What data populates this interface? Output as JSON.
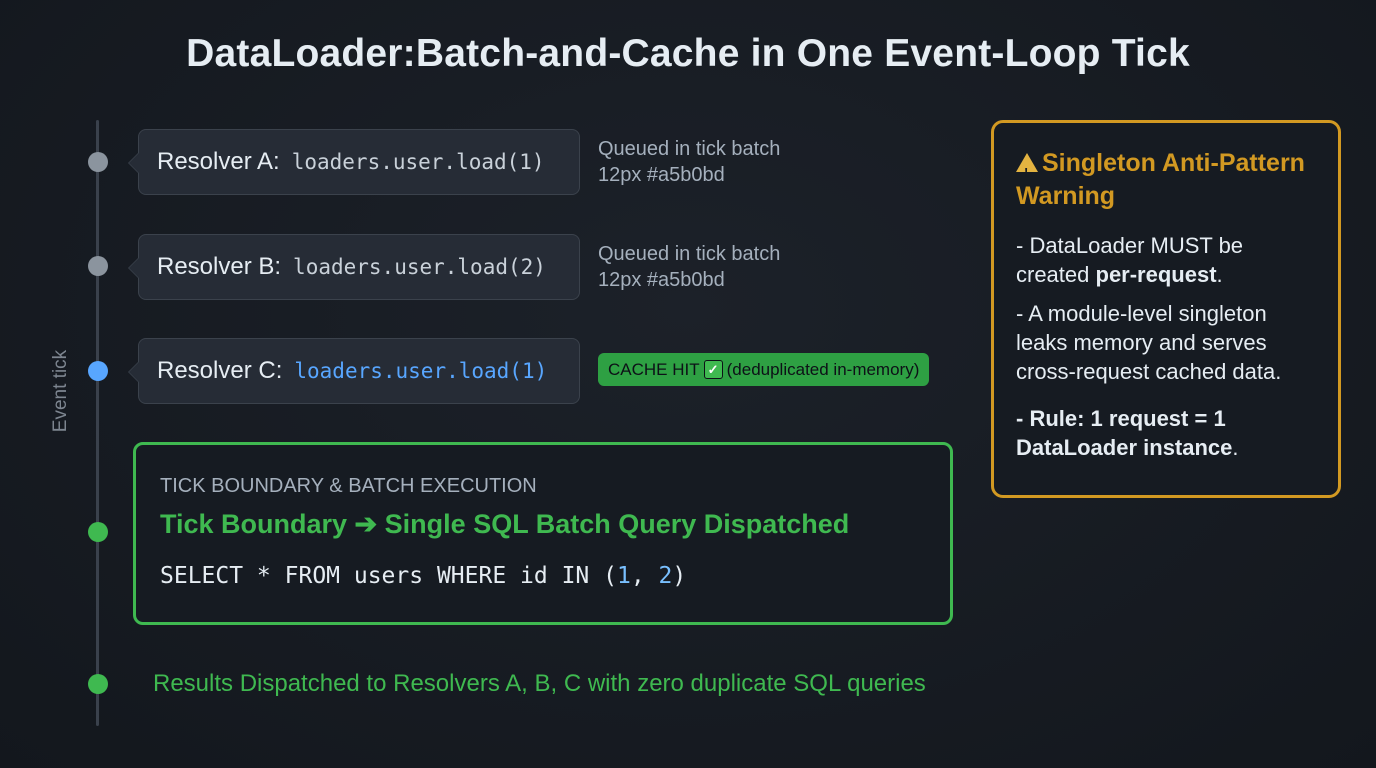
{
  "title": "DataLoader:Batch-and-Cache in One Event-Loop Tick",
  "axis_label": "Event tick",
  "resolvers": [
    {
      "label": "Resolver A:",
      "code": "loaders.user.load(1)",
      "note_line1": "Queued in tick batch",
      "note_line2": "12px #a5b0bd"
    },
    {
      "label": "Resolver B:",
      "code": "loaders.user.load(2)",
      "note_line1": "Queued in tick batch",
      "note_line2": "12px #a5b0bd"
    },
    {
      "label": "Resolver C:",
      "code": "loaders.user.load(1)",
      "badge_before": "CACHE HIT",
      "badge_after": "(deduplicated in-memory)"
    }
  ],
  "batch": {
    "heading": "TICK BOUNDARY & BATCH EXECUTION",
    "subheading": "Tick Boundary ➔ Single SQL Batch Query Dispatched",
    "sql_prefix": "SELECT * FROM users WHERE id IN (",
    "sql_id1": "1",
    "sql_sep": ", ",
    "sql_id2": "2",
    "sql_suffix": ")"
  },
  "results": "Results Dispatched to Resolvers A, B, C with zero duplicate SQL queries",
  "warning": {
    "title": "Singleton Anti-Pattern Warning",
    "item1_a": "- DataLoader MUST be created ",
    "item1_bold": "per-request",
    "item1_b": ".",
    "item2": "- A module-level singleton leaks memory and serves cross-request cached data.",
    "item3_bold": "- Rule: 1 request = 1 DataLoader instance",
    "item3_b": "."
  },
  "colors": {
    "background": "#161b22",
    "accent_green": "#3fb950",
    "accent_blue": "#58a6ff",
    "warning_amber": "#d29922",
    "muted_text": "#a5b0bd"
  },
  "icons": {
    "check": "check-icon",
    "warning": "warning-triangle-icon"
  }
}
